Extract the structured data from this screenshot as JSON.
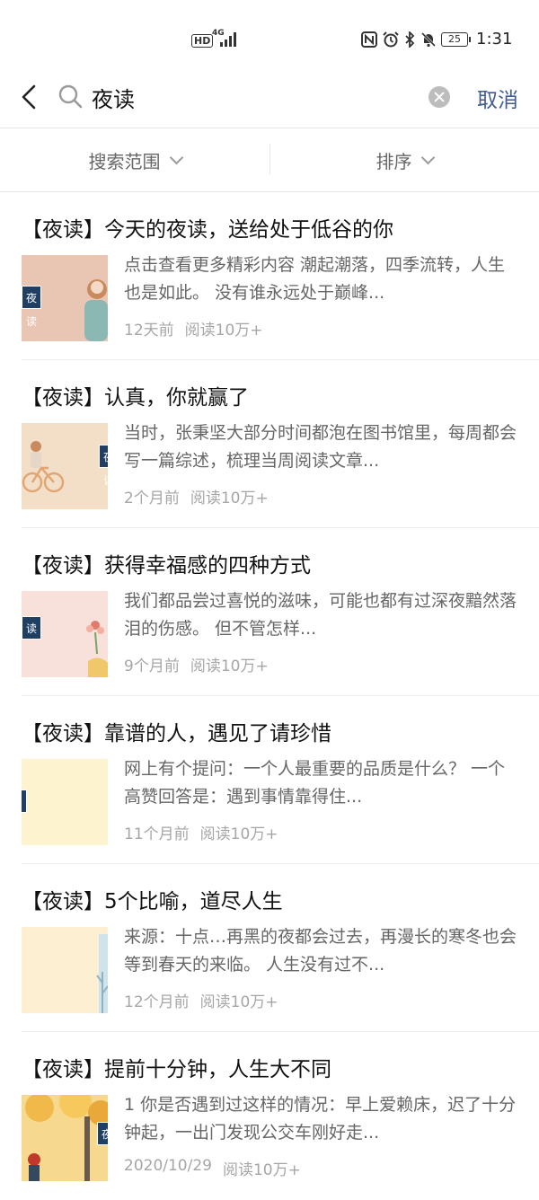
{
  "status_bar": {
    "hd": "HD",
    "network": "4G",
    "battery": "25",
    "time": "1:31"
  },
  "search": {
    "query": "夜读",
    "cancel_label": "取消"
  },
  "filters": {
    "scope_label": "搜索范围",
    "sort_label": "排序"
  },
  "results": [
    {
      "title": "【夜读】今天的夜读，送给处于低谷的你",
      "summary": "点击查看更多精彩内容 潮起潮落，四季流转，人生也是如此。 没有谁永远处于巅峰...",
      "time": "12天前",
      "reads": "阅读10万+",
      "thumb_bg": "#e9c6b3",
      "thumb_tag": "夜读"
    },
    {
      "title": "【夜读】认真，你就赢了",
      "summary": "当时，张秉坚大部分时间都泡在图书馆里，每周都会写一篇综述，梳理当周阅读文章...",
      "time": "2个月前",
      "reads": "阅读10万+",
      "thumb_bg": "#f3dfc7",
      "thumb_tag": "夜读"
    },
    {
      "title": "【夜读】获得幸福感的四种方式",
      "summary": "我们都品尝过喜悦的滋味，可能也都有过深夜黯然落泪的伤感。 但不管怎样...",
      "time": "9个月前",
      "reads": "阅读10万+",
      "thumb_bg": "#f8e1da",
      "thumb_tag": "读"
    },
    {
      "title": "【夜读】靠谱的人，遇见了请珍惜",
      "summary": "网上有个提问：一个人最重要的品质是什么？ 一个高赞回答是：遇到事情靠得住...",
      "time": "11个月前",
      "reads": "阅读10万+",
      "thumb_bg": "#fdf3cf",
      "thumb_tag": ""
    },
    {
      "title": "【夜读】5个比喻，道尽人生",
      "summary": "来源：十点…再黑的夜都会过去，再漫长的寒冬也会等到春天的来临。 人生没有过不...",
      "time": "12个月前",
      "reads": "阅读10万+",
      "thumb_bg": "#fcefd2",
      "thumb_tag": ""
    },
    {
      "title": "【夜读】提前十分钟，人生大不同",
      "summary": "1 你是否遇到过这样的情况：早上爱赖床，迟了十分钟起，一出门发现公交车刚好走...",
      "time": "2020/10/29",
      "reads": "阅读10万+",
      "thumb_bg": "#f6d88f",
      "thumb_tag": "夜"
    }
  ]
}
